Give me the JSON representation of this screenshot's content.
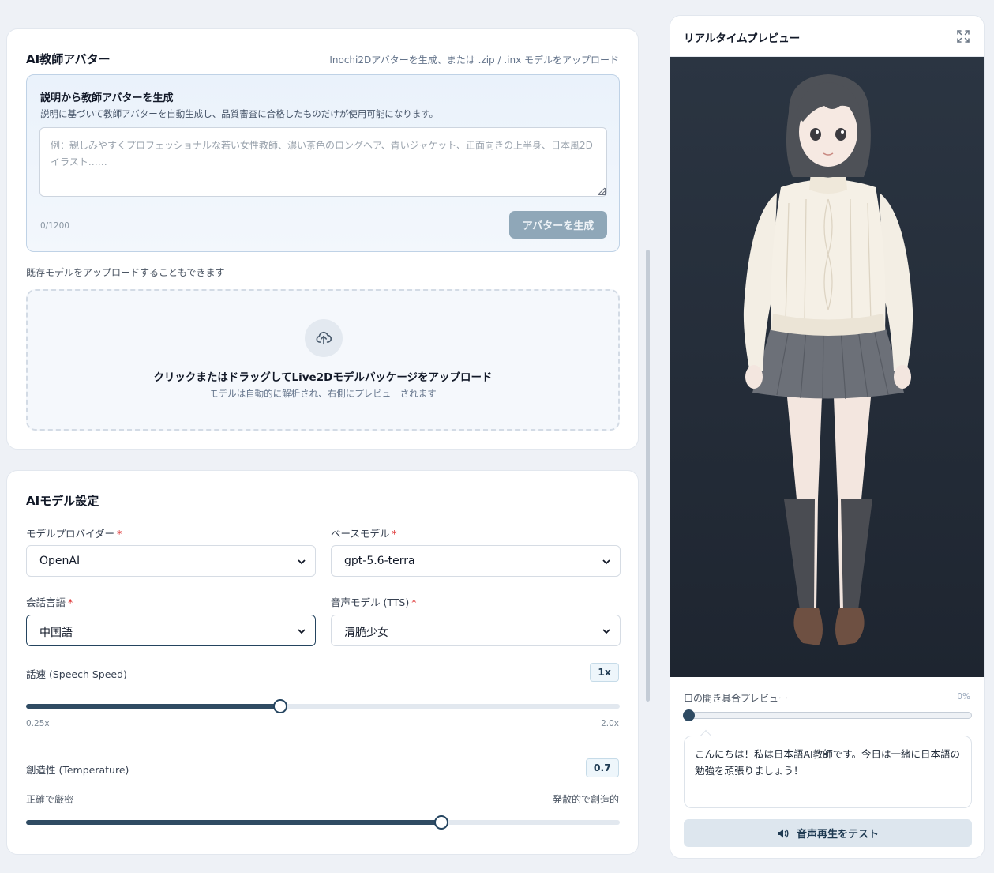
{
  "avatar_card": {
    "title": "AI教師アバター",
    "hint": "Inochi2Dアバターを生成、または .zip / .inx モデルをアップロード",
    "generate": {
      "title": "説明から教師アバターを生成",
      "description": "説明に基づいて教師アバターを自動生成し、品質審査に合格したものだけが使用可能になります。",
      "placeholder": "例：親しみやすくプロフェッショナルな若い女性教師、濃い茶色のロングヘア、青いジャケット、正面向きの上半身、日本風2Dイラスト……",
      "value": "",
      "char_count": "0/1200",
      "button_label": "アバターを生成"
    },
    "upload_note": "既存モデルをアップロードすることもできます",
    "dropzone": {
      "icon": "upload-cloud-icon",
      "main_text": "クリックまたはドラッグしてLive2Dモデルパッケージをアップロード",
      "sub_text": "モデルは自動的に解析され、右側にプレビューされます"
    }
  },
  "model_card": {
    "title": "AIモデル設定",
    "provider": {
      "label": "モデルプロバイダー",
      "required": "*",
      "value": "OpenAI"
    },
    "base_model": {
      "label": "ベースモデル",
      "required": "*",
      "value": "gpt-5.6-terra"
    },
    "language": {
      "label": "会話言語",
      "required": "*",
      "value": "中国語"
    },
    "tts": {
      "label": "音声モデル (TTS)",
      "required": "*",
      "value": "清脆少女"
    },
    "speech_speed": {
      "label": "話速 (Speech Speed)",
      "badge": "1x",
      "min_label": "0.25x",
      "max_label": "2.0x",
      "min": 0.25,
      "max": 2.0,
      "value": 1.0
    },
    "temperature": {
      "label": "創造性 (Temperature)",
      "badge": "0.7",
      "left_label": "正確で厳密",
      "right_label": "発散的で創造的",
      "min": 0,
      "max": 1,
      "value": 0.7
    }
  },
  "preview": {
    "title": "リアルタイムプレビュー",
    "expand_icon": "expand-icon",
    "mouth": {
      "label": "口の開き具合プレビュー",
      "value_text": "0%",
      "value": 0
    },
    "speech_text": "こんにちは！私は日本語AI教師です。今日は一緒に日本語の勉強を頑張りましょう！",
    "tts_button": {
      "icon": "speaker-icon",
      "label": "音声再生をテスト"
    }
  },
  "colors": {
    "accent": "#2f4b63",
    "required": "#dc2626",
    "stage_bg": "#222b36"
  }
}
